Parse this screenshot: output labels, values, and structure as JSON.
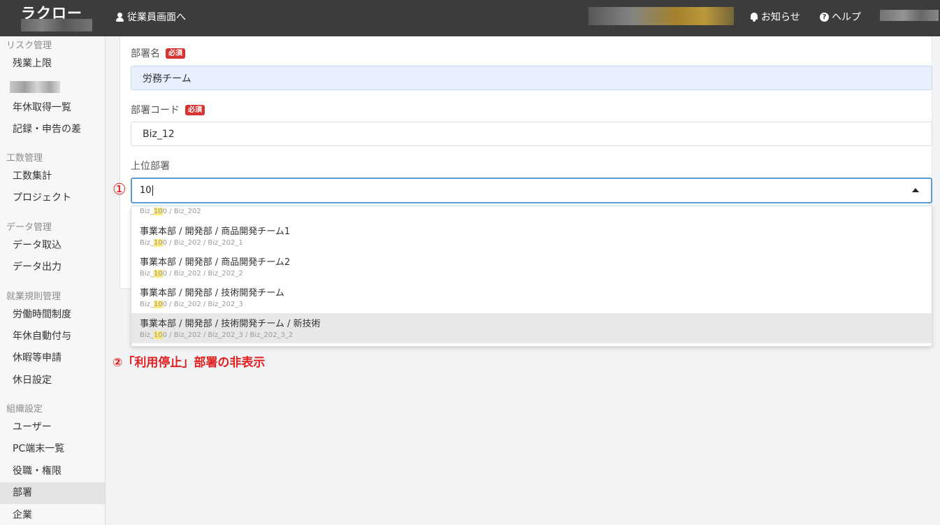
{
  "header": {
    "logo": "ラクロー",
    "employee_link": "従業員画面へ",
    "notice": "お知らせ",
    "help": "ヘルプ"
  },
  "sidebar": {
    "risk_category": "リスク管理",
    "overtime_limit": "残業上限",
    "leave_list": "年休取得一覧",
    "record_diff": "記録・申告の差",
    "effort_category": "工数管理",
    "effort_total": "工数集計",
    "project": "プロジェクト",
    "data_category": "データ管理",
    "data_import": "データ取込",
    "data_export": "データ出力",
    "rules_category": "就業規則管理",
    "work_hours": "労働時間制度",
    "auto_leave": "年休自動付与",
    "leave_request": "休暇等申請",
    "holiday": "休日設定",
    "org_category": "組織設定",
    "users": "ユーザー",
    "pc_list": "PC端末一覧",
    "roles": "役職・権限",
    "departments": "部署",
    "company": "企業"
  },
  "form": {
    "dept_name_label": "部署名",
    "required": "必須",
    "dept_name_value": "労務チーム",
    "dept_code_label": "部署コード",
    "dept_code_value": "Biz_12",
    "parent_label": "上位部署",
    "parent_value": "10"
  },
  "dropdown": {
    "options": [
      {
        "name": "",
        "pre": "Biz_",
        "hl": "10",
        "post": "0 / Biz_202"
      },
      {
        "name": "事業本部 / 開発部 / 商品開発チーム1",
        "pre": "Biz_",
        "hl": "10",
        "post": "0 / Biz_202 / Biz_202_1"
      },
      {
        "name": "事業本部 / 開発部 / 商品開発チーム2",
        "pre": "Biz_",
        "hl": "10",
        "post": "0 / Biz_202 / Biz_202_2"
      },
      {
        "name": "事業本部 / 開発部 / 技術開発チーム",
        "pre": "Biz_",
        "hl": "10",
        "post": "0 / Biz_202 / Biz_202_3"
      },
      {
        "name": "事業本部 / 開発部 / 技術開発チーム / 新技術",
        "pre": "Biz_",
        "hl": "10",
        "post": "0 / Biz_202 / Biz_202_3 / Biz_202_3_2"
      }
    ]
  },
  "annotations": {
    "mark1": "①",
    "mark2": "②「利用停止」部署の非表示"
  },
  "colors": {
    "header_bg": "#3c3c3c",
    "badge": "#d63333",
    "annotation": "#e02020",
    "focus_border": "#5b9bd5"
  }
}
